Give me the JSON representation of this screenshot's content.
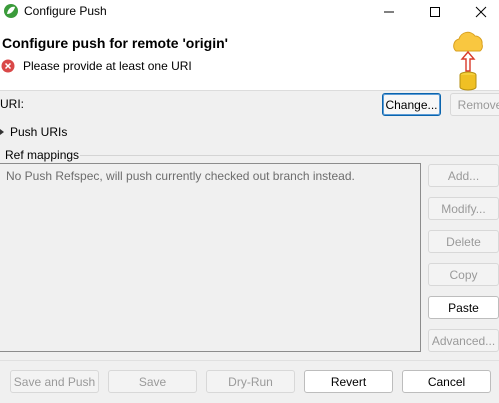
{
  "window": {
    "title": "Configure Push",
    "app_icon": "eclipse-leaf-icon",
    "controls": [
      "minimize-icon",
      "maximize-icon",
      "close-icon"
    ]
  },
  "header": {
    "title": "Configure push for remote 'origin'",
    "error_message": "Please provide at least one URI",
    "error_icon": "error-icon",
    "banner_icon": "cloud-push-database-icon"
  },
  "uri": {
    "label": "URI:",
    "change_label": "Change...",
    "remove_label": "Remove"
  },
  "push_uris": {
    "label": "Push URIs"
  },
  "ref_mappings": {
    "label": "Ref mappings",
    "placeholder": "No Push Refspec, will push currently checked out branch instead.",
    "buttons": {
      "add": "Add...",
      "modify": "Modify...",
      "delete": "Delete",
      "copy": "Copy",
      "paste": "Paste",
      "advanced": "Advanced..."
    }
  },
  "footer": {
    "save_and_push": "Save and Push",
    "save": "Save",
    "dry_run": "Dry-Run",
    "revert": "Revert",
    "cancel": "Cancel"
  },
  "colors": {
    "error": "#d94848",
    "focus_border": "#0a64ad",
    "disabled_text": "#9a9a9a",
    "app_icon_green": "#3a9b3a"
  }
}
